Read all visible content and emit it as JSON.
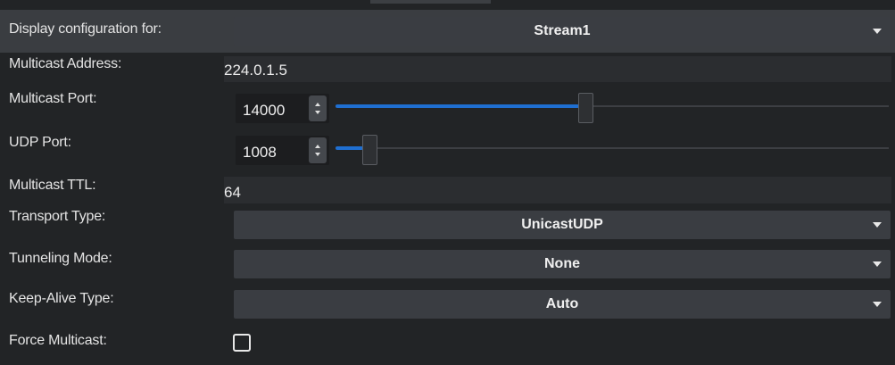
{
  "colors": {
    "background": "#222426",
    "row_highlight": "#3a3d41",
    "dropdown_bg": "#3a3d42",
    "slider_fill": "#1f6fd1",
    "text": "#e6e6e6"
  },
  "rows": {
    "display_config": {
      "label": "Display configuration for:",
      "value": "Stream1",
      "icon": "chevron-down-icon"
    },
    "multicast_address": {
      "label": "Multicast Address:",
      "value": "224.0.1.5"
    },
    "multicast_port": {
      "label": "Multicast Port:",
      "value": "14000",
      "slider_fraction": 0.44
    },
    "udp_port": {
      "label": "UDP Port:",
      "value": "1008",
      "slider_fraction": 0.05
    },
    "multicast_ttl": {
      "label": "Multicast TTL:",
      "value": "64"
    },
    "transport_type": {
      "label": "Transport Type:",
      "value": "UnicastUDP",
      "icon": "chevron-down-icon"
    },
    "tunneling_mode": {
      "label": "Tunneling Mode:",
      "value": "None",
      "icon": "chevron-down-icon"
    },
    "keep_alive_type": {
      "label": "Keep-Alive Type:",
      "value": "Auto",
      "icon": "chevron-down-icon"
    },
    "force_multicast": {
      "label": "Force Multicast:",
      "checked": false
    }
  }
}
